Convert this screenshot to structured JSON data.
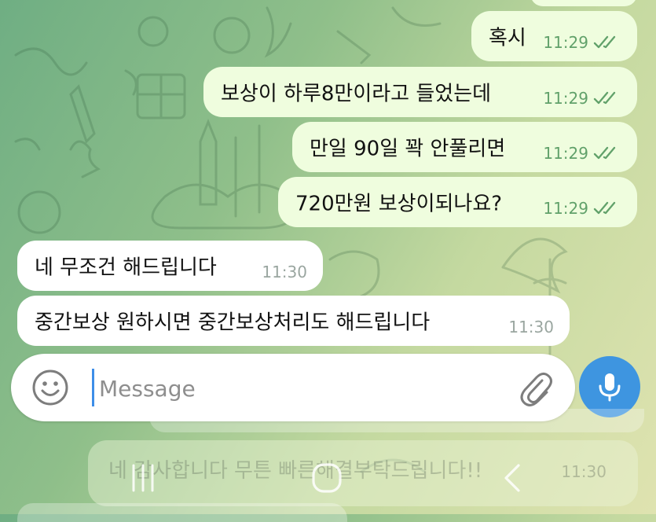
{
  "chat": {
    "messages": [
      {
        "text": "혹시",
        "time": "11:29",
        "outgoing": true
      },
      {
        "text": "보상이 하루8만이라고 들었는데",
        "time": "11:29",
        "outgoing": true
      },
      {
        "text": "만일 90일 꽉 안풀리면",
        "time": "11:29",
        "outgoing": true
      },
      {
        "text": "720만원 보상이되나요?",
        "time": "11:29",
        "outgoing": true
      },
      {
        "text": "네 무조건 해드립니다",
        "time": "11:30",
        "outgoing": false
      },
      {
        "text": "중간보상 원하시면 중간보상처리도 해드립니다",
        "time": "11:30",
        "outgoing": false
      }
    ],
    "background_message": {
      "text": "네 감사합니다 무튼 빠른해결부탁드립니다!!",
      "time": "11:30"
    }
  },
  "composer": {
    "placeholder": "Message",
    "emoji_icon": "smile-icon",
    "attach_icon": "paperclip-icon",
    "mic_icon": "microphone-icon"
  },
  "navbar": {
    "icons": [
      "recent-apps-icon",
      "home-icon",
      "back-icon"
    ]
  },
  "colors": {
    "outgoing_bubble": "#effdde",
    "incoming_bubble": "#ffffff",
    "time_outgoing": "#61a16a",
    "time_incoming": "#9aa6a0",
    "accent": "#3e95e0"
  }
}
